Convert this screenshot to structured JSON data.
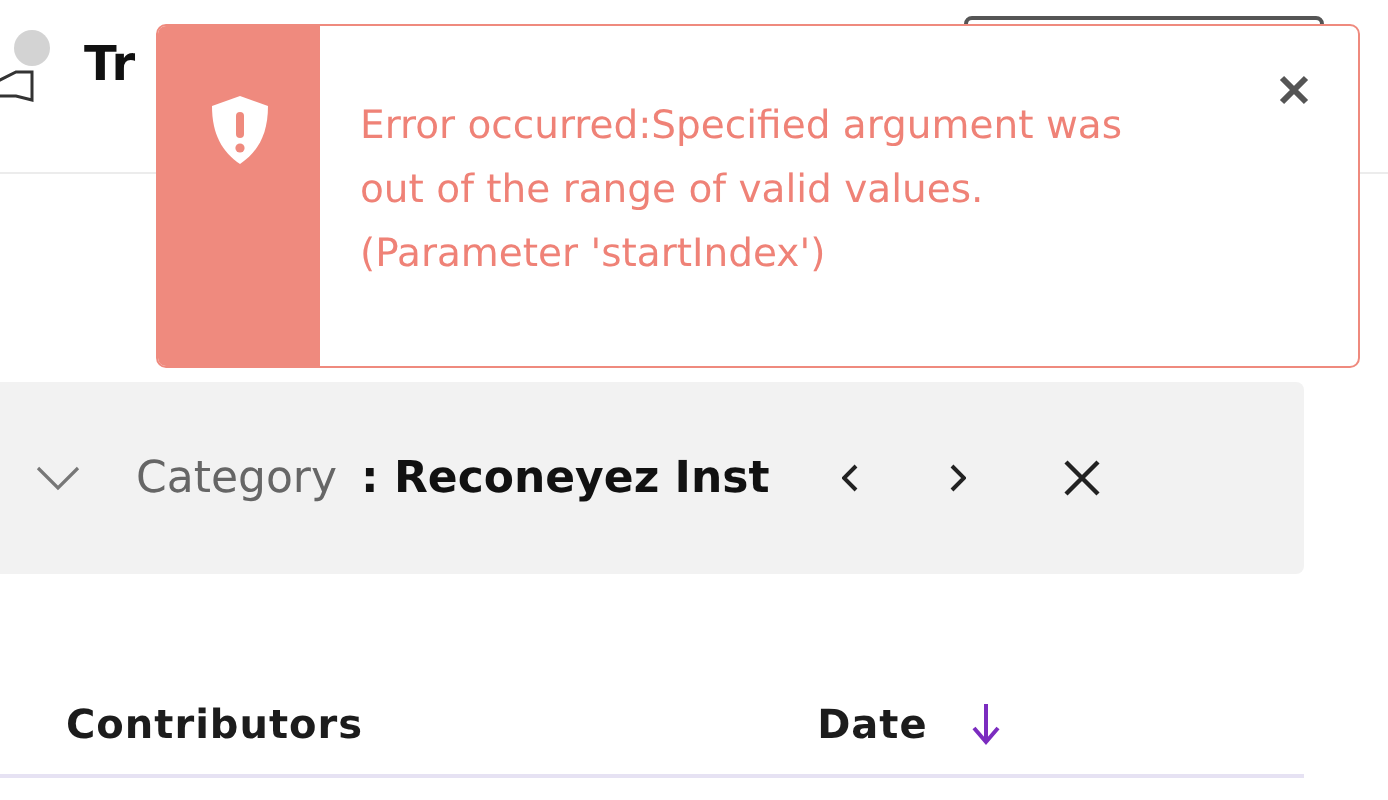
{
  "header": {
    "title": "Tr"
  },
  "toast": {
    "kind": "error",
    "message": "Error occurred:Specified argument was out of the range of valid values. (Parameter 'startIndex')"
  },
  "filter_bar": {
    "expanded": false,
    "label": "Category",
    "value": ": Reconeyez Inst"
  },
  "table": {
    "columns": [
      {
        "label": "Contributors",
        "sorted": false
      },
      {
        "label": "Date",
        "sorted": true
      }
    ]
  }
}
